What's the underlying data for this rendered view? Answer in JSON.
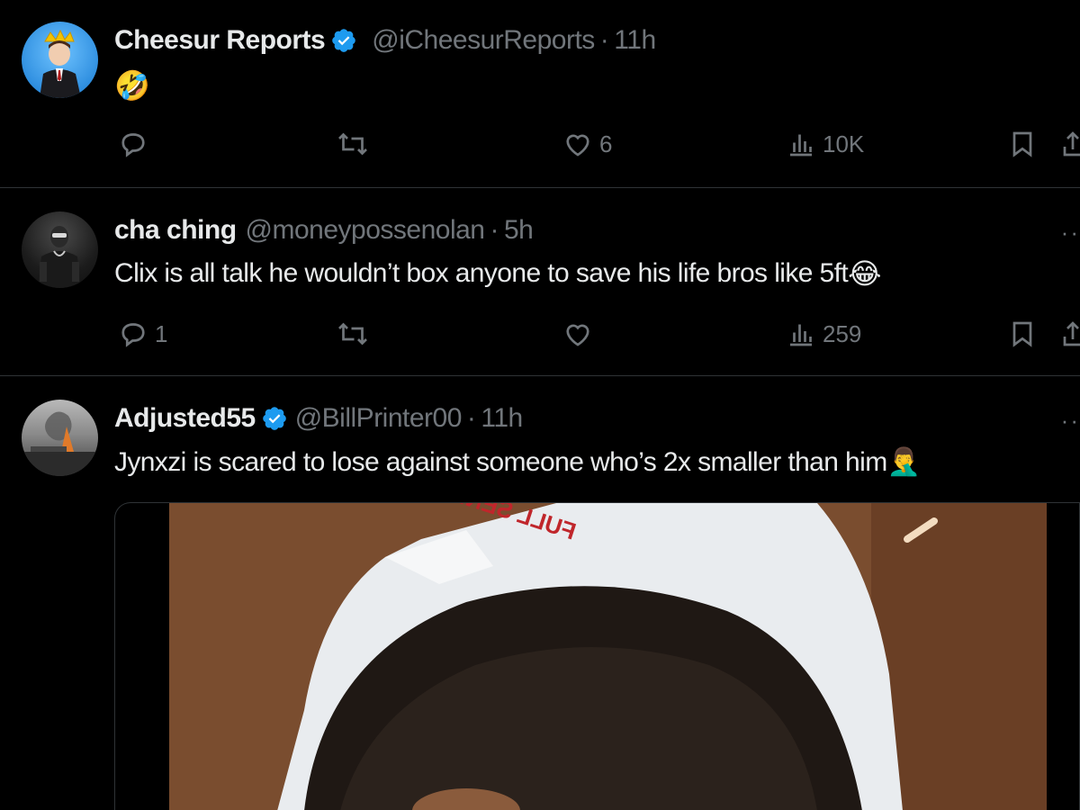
{
  "tweets": [
    {
      "name": "Cheesur Reports",
      "verified": true,
      "handle": "@iCheesurReports",
      "separator": "·",
      "time": "11h",
      "text": "",
      "emoji": "🤣",
      "actions": {
        "replies": "",
        "retweets": "",
        "likes": "6",
        "views": "10K"
      }
    },
    {
      "name": "cha ching",
      "verified": false,
      "handle": "@moneypossenolan",
      "separator": "·",
      "time": "5h",
      "text": "Clix is all talk he wouldn’t box anyone to save his life bros like 5ft",
      "emoji": "😂",
      "actions": {
        "replies": "1",
        "retweets": "",
        "likes": "",
        "views": "259"
      }
    },
    {
      "name": "Adjusted55",
      "verified": true,
      "handle": "@BillPrinter00",
      "separator": "·",
      "time": "11h",
      "text": "Jynxzi is scared to lose against someone who’s 2x smaller than him ",
      "emoji": "🤦‍♂️",
      "media_caption_text": "FULL SEND"
    }
  ],
  "more_glyph": "··",
  "colors": {
    "background": "#000000",
    "secondary_text": "#71767b",
    "verified_blue": "#1d9bf0",
    "divider": "#2f3336"
  }
}
